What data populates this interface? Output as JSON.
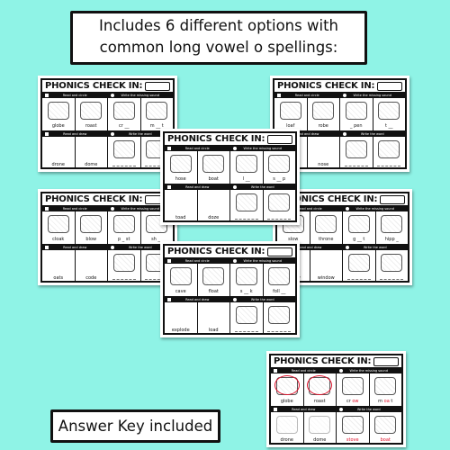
{
  "banner": {
    "line1": "Includes 6 different options with",
    "line2": "common long vowel o spellings:"
  },
  "answer_key_label": "Answer Key included",
  "colors": {
    "background": "#8ff3e6",
    "answer_red": "#e0102a"
  },
  "card_common": {
    "title": "PHONICS CHECK IN:",
    "section_read_circle": "Read and circle",
    "section_missing_sound": "Write the missing sound",
    "section_read_draw": "Read and draw",
    "section_write_word": "Write the word"
  },
  "cards": [
    {
      "id": "card-1",
      "top": [
        "globe",
        "roast",
        "cr __",
        "m __ t"
      ],
      "bottom": [
        "drone",
        "dome"
      ]
    },
    {
      "id": "card-2",
      "top": [
        "loaf",
        "robe",
        "_ pen",
        "t __"
      ],
      "bottom": [
        "pillow",
        "nose"
      ]
    },
    {
      "id": "card-4",
      "top": [
        "cloak",
        "blow",
        "p _ st",
        "sh __"
      ],
      "bottom": [
        "oats",
        "code"
      ]
    },
    {
      "id": "card-5",
      "top": [
        "slow",
        "throne",
        "g __ t",
        "hipp _"
      ],
      "bottom": [
        "yellow",
        "window"
      ]
    },
    {
      "id": "card-3",
      "top": [
        "hose",
        "boat",
        "l __",
        "s __ p"
      ],
      "bottom": [
        "toad",
        "doze"
      ]
    },
    {
      "id": "card-6",
      "top": [
        "cave",
        "float",
        "s __ k",
        "foll __"
      ],
      "bottom": [
        "explode",
        "load"
      ]
    }
  ],
  "answer_card": {
    "top": [
      "globe",
      "roast"
    ],
    "missing": [
      {
        "prefix": "cr ",
        "answer": "ow",
        "suffix": ""
      },
      {
        "prefix": "m ",
        "answer": "oa",
        "suffix": " t"
      }
    ],
    "bottom": [
      "drone",
      "dome"
    ],
    "written": [
      "stove",
      "boat"
    ]
  }
}
